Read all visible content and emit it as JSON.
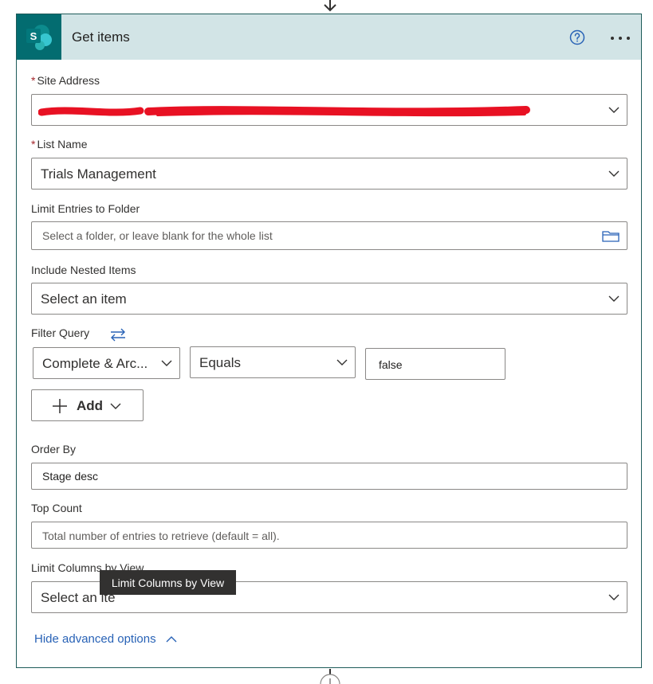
{
  "header": {
    "title": "Get items",
    "logo_letter": "S"
  },
  "fields": {
    "site_address": {
      "label": "Site Address",
      "required_mark": "*",
      "value": ""
    },
    "list_name": {
      "label": "List Name",
      "required_mark": "*",
      "value": "Trials Management"
    },
    "limit_folder": {
      "label": "Limit Entries to Folder",
      "placeholder": "Select a folder, or leave blank for the whole list"
    },
    "nested_items": {
      "label": "Include Nested Items",
      "value": "Select an item"
    },
    "filter_query": {
      "label": "Filter Query",
      "field": "Complete & Arc...",
      "operator": "Equals",
      "value": "false",
      "add_label": "Add"
    },
    "order_by": {
      "label": "Order By",
      "value": "Stage desc"
    },
    "top_count": {
      "label": "Top Count",
      "placeholder": "Total number of entries to retrieve (default = all)."
    },
    "limit_columns": {
      "label": "Limit Columns by View",
      "value": "Select an ite",
      "tooltip": "Limit Columns by View"
    }
  },
  "footer": {
    "hide_advanced": "Hide advanced options"
  },
  "colors": {
    "accent": "#036c70",
    "header_bg": "#d2e4e6",
    "link": "#2862b6",
    "required": "#a4262c",
    "redaction": "#e81123"
  }
}
